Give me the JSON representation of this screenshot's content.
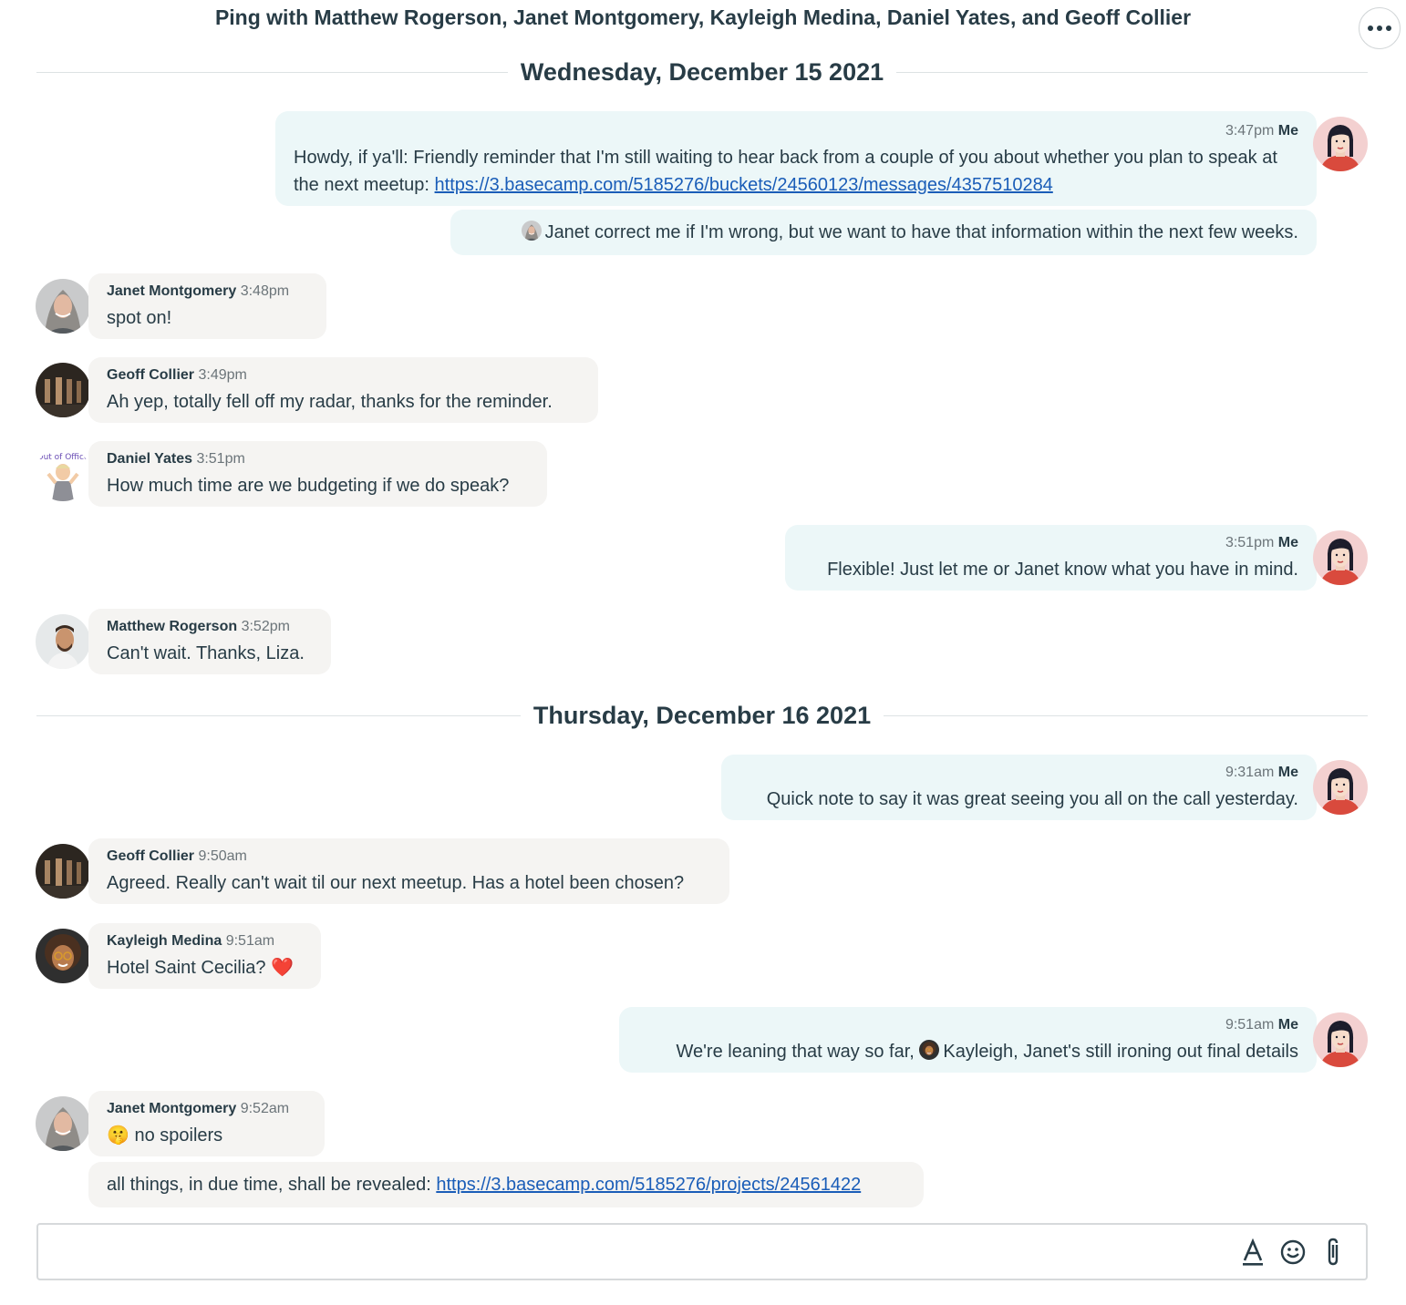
{
  "header": {
    "title": "Ping with Matthew Rogerson, Janet Montgomery, Kayleigh Medina, Daniel Yates, and Geoff Collier"
  },
  "days": [
    {
      "label": "Wednesday, December 15 2021"
    },
    {
      "label": "Thursday, December 16 2021"
    }
  ],
  "messages": [
    {
      "sender": "Me",
      "time": "3:47pm",
      "text": "Howdy, if ya'll: Friendly reminder that I'm still waiting to hear back from a couple of you about whether you plan to speak at the next meetup: ",
      "link": "https://3.basecamp.com/5185276/buckets/24560123/messages/4357510284"
    },
    {
      "sender": "Me",
      "text": "Janet correct me if I'm wrong, but we want to have that information within the next few weeks."
    },
    {
      "sender": "Janet Montgomery",
      "time": "3:48pm",
      "text": "spot on!"
    },
    {
      "sender": "Geoff Collier",
      "time": "3:49pm",
      "text": "Ah yep, totally fell off my radar, thanks for the reminder."
    },
    {
      "sender": "Daniel Yates",
      "time": "3:51pm",
      "text": "How much time are we budgeting if we do speak?"
    },
    {
      "sender": "Me",
      "time": "3:51pm",
      "text": "Flexible! Just let me or Janet know what you have in mind."
    },
    {
      "sender": "Matthew Rogerson",
      "time": "3:52pm",
      "text": "Can't wait. Thanks, Liza."
    },
    {
      "sender": "Me",
      "time": "9:31am",
      "text": "Quick note to say it was great seeing you all on the call yesterday."
    },
    {
      "sender": "Geoff Collier",
      "time": "9:50am",
      "text": "Agreed. Really can't wait til our next meetup. Has a hotel been chosen?"
    },
    {
      "sender": "Kayleigh Medina",
      "time": "9:51am",
      "text": "Hotel Saint Cecilia? ❤️"
    },
    {
      "sender": "Me",
      "time": "9:51am",
      "text_before": "We're leaning that way so far, ",
      "text_after": "Kayleigh, Janet's still ironing out final details"
    },
    {
      "sender": "Janet Montgomery",
      "time": "9:52am",
      "text": "🤫 no spoilers"
    },
    {
      "sender": "Janet Montgomery",
      "text": "all things, in due time, shall be revealed: ",
      "link": "https://3.basecamp.com/5185276/projects/24561422"
    }
  ],
  "composer": {
    "icons": [
      "text-format-icon",
      "emoji-icon",
      "attachment-icon"
    ]
  },
  "colors": {
    "me_bubble": "#ecf7f8",
    "them_bubble": "#f5f4f2",
    "link": "#1a5db8",
    "heading": "#283c46"
  }
}
